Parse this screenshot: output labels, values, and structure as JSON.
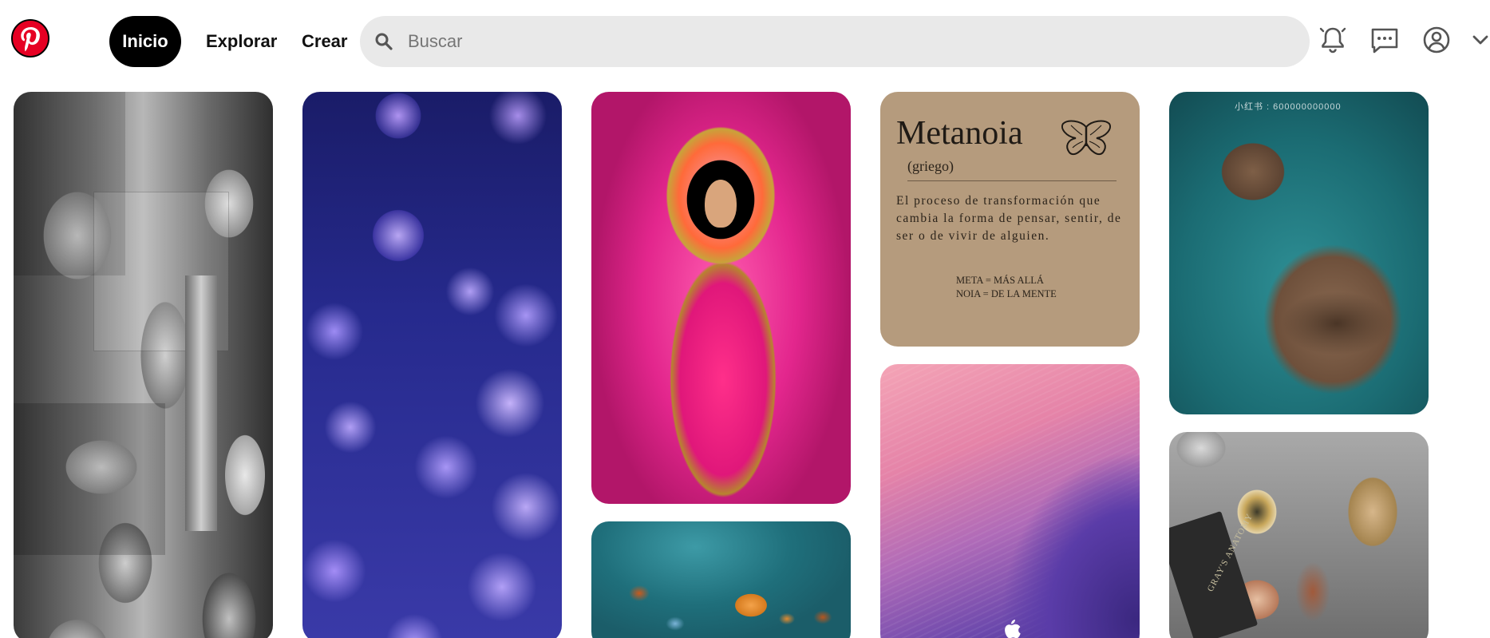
{
  "header": {
    "logo_name": "pinterest-logo",
    "nav": {
      "home_label": "Inicio",
      "explore_label": "Explorar",
      "create_label": "Crear"
    },
    "search": {
      "placeholder": "Buscar",
      "value": ""
    },
    "icons": [
      "bell-icon",
      "messages-icon",
      "profile-icon",
      "chevron-down-icon"
    ]
  },
  "pins": [
    {
      "name": "pin-statues-collage",
      "icon": "image"
    },
    {
      "name": "pin-jellyfish",
      "icon": "image"
    },
    {
      "name": "pin-virgin-painting",
      "icon": "image"
    },
    {
      "name": "pin-butterflies",
      "icon": "image"
    },
    {
      "name": "pin-metanoia",
      "title": "Metanoia",
      "subtitle": "(griego)",
      "body": "El proceso de transformación que cambia la forma de pensar, sentir, de ser o de vivir de alguien.",
      "note1": "META = MÁS ALLÁ",
      "note2": "NOIA = DE LA MENTE"
    },
    {
      "name": "pin-purple-waves",
      "icon": "apple-logo"
    },
    {
      "name": "pin-otters",
      "watermark": "小红书 : 600000000000"
    },
    {
      "name": "pin-anatomy",
      "book_label": "GRAY'S ANATOMY"
    }
  ],
  "colors": {
    "brand": "#e60023",
    "active_nav_bg": "#000000",
    "search_bg": "#e9e9e9"
  }
}
